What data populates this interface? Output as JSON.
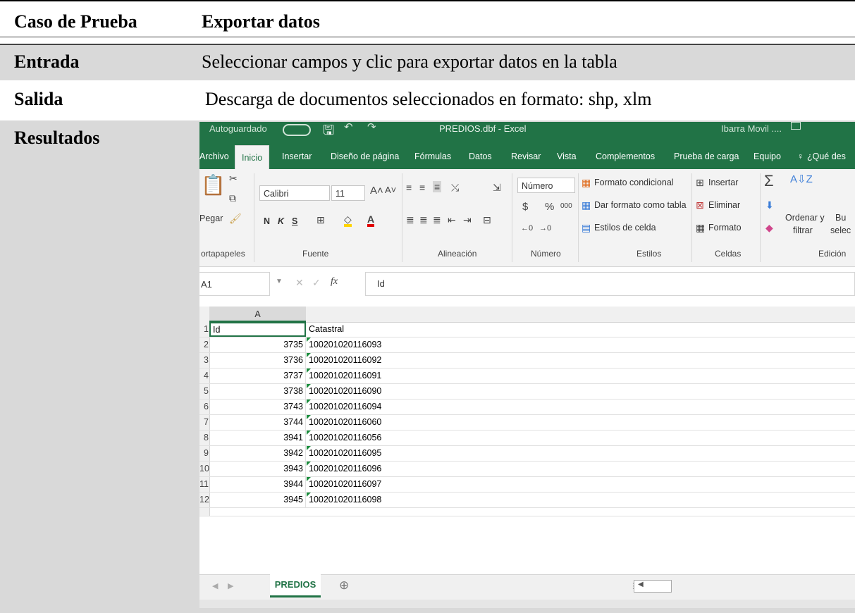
{
  "doc": {
    "rows": [
      {
        "label": "Caso de Prueba",
        "value": "Exportar datos"
      },
      {
        "label": "Entrada",
        "value": "Seleccionar campos y clic para exportar datos en la tabla"
      },
      {
        "label": "Salida",
        "value": "Descarga de documentos seleccionados en formato: shp, xlm"
      },
      {
        "label": "Resultados"
      }
    ]
  },
  "excel": {
    "title": {
      "autosave": "Autoguardado",
      "filename": "PREDIOS.dbf  -  Excel",
      "user": "Ibarra Movil ...."
    },
    "menu": [
      "Archivo",
      "Inicio",
      "Insertar",
      "Diseño de página",
      "Fórmulas",
      "Datos",
      "Revisar",
      "Vista",
      "Complementos",
      "Prueba de carga",
      "Equipo",
      "¿Qué des"
    ],
    "ribbon": {
      "paste": "Pegar",
      "font_name": "Calibri",
      "font_size": "11",
      "bold": "N",
      "italic": "K",
      "underline": "S",
      "number_format": "Número",
      "conditional_format": "Formato condicional",
      "format_as_table": "Dar formato como tabla",
      "cell_styles": "Estilos de celda",
      "insert": "Insertar",
      "delete": "Eliminar",
      "format": "Formato",
      "sort_filter_1": "Ordenar y",
      "sort_filter_2": "filtrar",
      "find_1": "Bu",
      "find_2": "selec",
      "groups": [
        "ortapapeles",
        "Fuente",
        "Alineación",
        "Número",
        "Estilos",
        "Celdas",
        "Edición"
      ]
    },
    "formula_bar": {
      "name_box": "A1",
      "fx": "fx",
      "content": "Id"
    },
    "grid": {
      "column_a": "A",
      "header_row": {
        "row": "1",
        "a": "Id",
        "b": "Catastral"
      },
      "rows": [
        {
          "row": "2",
          "id": "3735",
          "catastral": "100201020116093"
        },
        {
          "row": "3",
          "id": "3736",
          "catastral": "100201020116092"
        },
        {
          "row": "4",
          "id": "3737",
          "catastral": "100201020116091"
        },
        {
          "row": "5",
          "id": "3738",
          "catastral": "100201020116090"
        },
        {
          "row": "6",
          "id": "3743",
          "catastral": "100201020116094"
        },
        {
          "row": "7",
          "id": "3744",
          "catastral": "100201020116060"
        },
        {
          "row": "8",
          "id": "3941",
          "catastral": "100201020116056"
        },
        {
          "row": "9",
          "id": "3942",
          "catastral": "100201020116095"
        },
        {
          "row": "10",
          "id": "3943",
          "catastral": "100201020116096"
        },
        {
          "row": "11",
          "id": "3944",
          "catastral": "100201020116097"
        },
        {
          "row": "12",
          "id": "3945",
          "catastral": "100201020116098"
        }
      ]
    },
    "sheet_tab": "PREDIOS",
    "colors": {
      "excel_green": "#217346",
      "row_shade": "#d9d9d9"
    }
  }
}
